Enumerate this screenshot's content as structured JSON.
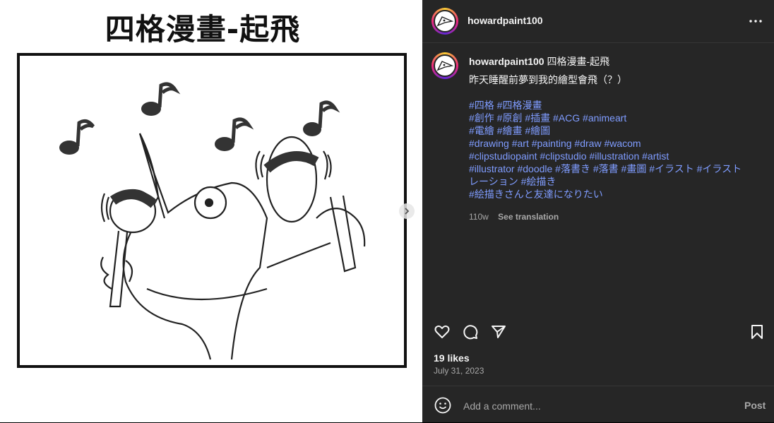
{
  "media": {
    "comic_title": "四格漫畫-起飛"
  },
  "header": {
    "username": "howardpaint100"
  },
  "caption": {
    "username": "howardpaint100",
    "title": "四格漫畫-起飛",
    "body": "昨天睡醒前夢到我的繪型會飛（？）",
    "hashtags": [
      "#四格 #四格漫畫",
      "#創作 #原創 #插畫 #ACG #animeart",
      "#電繪 #繪畫 #繪圖",
      "#drawing #art #painting #draw #wacom",
      "#clipstudiopaint #clipstudio #illustration #artist",
      "#illustrator #doodle #落書き #落書 #畫圖 #イラスト #イラスト",
      "レーション #絵描き",
      "#絵描きさんと友達になりたい"
    ],
    "age": "110w",
    "see_translation": "See translation"
  },
  "stats": {
    "likes": "19 likes",
    "date": "July 31, 2023"
  },
  "comment": {
    "placeholder": "Add a comment...",
    "post_label": "Post"
  },
  "icons": {
    "more": "more-options-icon",
    "like": "heart-icon",
    "comment": "comment-icon",
    "share": "send-icon",
    "save": "bookmark-icon",
    "emoji": "emoji-icon",
    "next": "chevron-right-icon"
  },
  "colors": {
    "pane_bg": "#262626",
    "hashtag": "#7f9cff",
    "muted": "#a8a8a8"
  }
}
